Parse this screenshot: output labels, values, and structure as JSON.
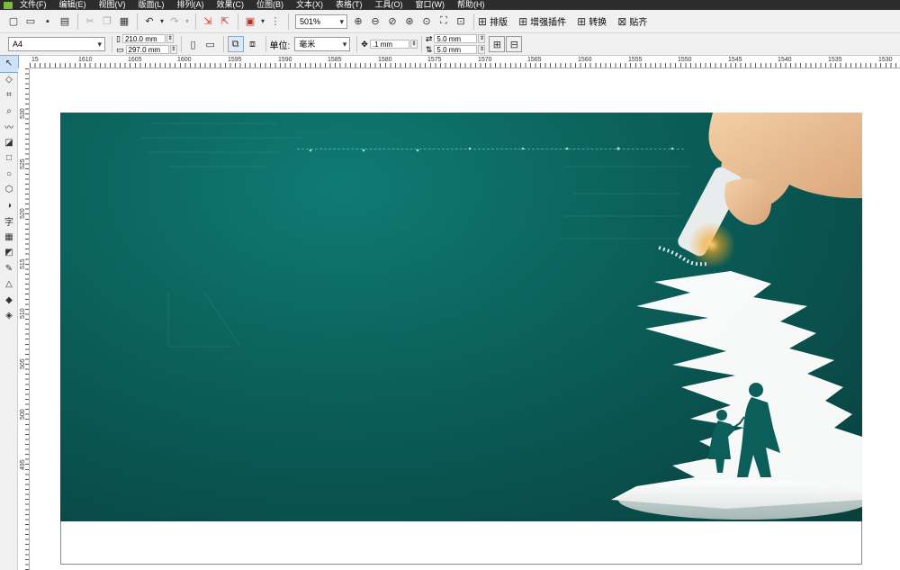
{
  "menu": [
    "文件(F)",
    "编辑(E)",
    "视图(V)",
    "版面(L)",
    "排列(A)",
    "效果(C)",
    "位图(B)",
    "文本(X)",
    "表格(T)",
    "工具(O)",
    "窗口(W)",
    "帮助(H)"
  ],
  "toolbar": {
    "zoom_value": "501%",
    "buttons": {
      "layout": "排版",
      "plugins": "增强插件",
      "convert": "转换",
      "snap": "贴齐"
    }
  },
  "property_bar": {
    "page_size": "A4",
    "width": "210.0 mm",
    "height": "297.0 mm",
    "unit_label": "单位:",
    "unit_value": "毫米",
    "nudge": ".1 mm",
    "dup_x": "5.0 mm",
    "dup_y": "5.0 mm"
  },
  "ruler": {
    "h_labels": [
      "15",
      "1610",
      "1605",
      "1600",
      "1595",
      "1590",
      "1585",
      "1580",
      "1575",
      "1570",
      "1565",
      "1560",
      "1555",
      "1550",
      "1545",
      "1540",
      "1535",
      "1530"
    ],
    "v_labels": [
      "530",
      "525",
      "520",
      "515",
      "510",
      "505",
      "500",
      "495"
    ]
  },
  "tools": [
    "pick-tool",
    "shape-tool",
    "crop-tool",
    "zoom-tool",
    "freehand-tool",
    "smart-fill-tool",
    "rectangle-tool",
    "ellipse-tool",
    "polygon-tool",
    "basic-shapes-tool",
    "text-tool",
    "table-tool",
    "interactive-tool",
    "eyedropper-tool",
    "outline-tool",
    "fill-tool",
    "interactive-fill-tool"
  ],
  "colors": {
    "accent": "#0b5e59",
    "menubar": "#2c2c2c"
  }
}
